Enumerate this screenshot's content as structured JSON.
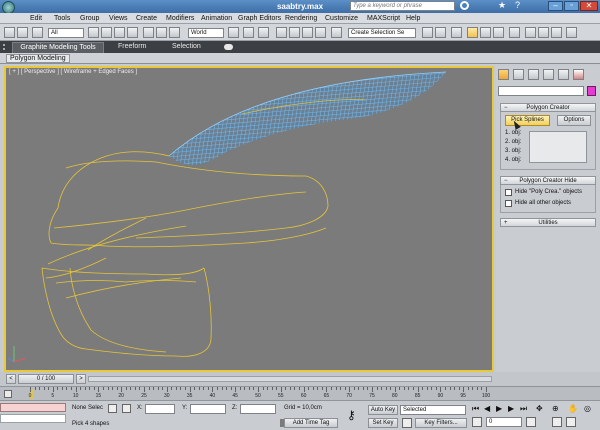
{
  "window": {
    "title": "saabtry.max",
    "search_placeholder": "Type a keyword or phrase"
  },
  "menu": [
    "Edit",
    "Tools",
    "Group",
    "Views",
    "Create",
    "Modifiers",
    "Animation",
    "Graph Editors",
    "Rendering",
    "Customize",
    "MAXScript",
    "Help"
  ],
  "toolbar": {
    "selection_filter": "All",
    "reference_coord": "World",
    "selection_set": "Create Selection Se"
  },
  "ribbon": {
    "tabs": [
      "Graphite Modeling Tools",
      "Freeform",
      "Selection"
    ],
    "subtab": "Polygon Modeling"
  },
  "viewport": {
    "label": "[ + ] [ Perspective ] [ Wireframe + Edged Faces ]"
  },
  "panel": {
    "rollout1": "Polygon Creator",
    "pick_button": "Pick Splines",
    "options_button": "Options",
    "list": [
      "1. obj:",
      "2. obj:",
      "3. obj:",
      "4. obj:"
    ],
    "rollout2": "Polygon Creator Hide",
    "checks": [
      "Hide \"Poly Crea.\" objects",
      "Hide all other objects"
    ],
    "rollout3": "Utilities"
  },
  "timeline": {
    "frame": "0 / 100",
    "ticks": [
      "0",
      "5",
      "10",
      "15",
      "20",
      "25",
      "30",
      "35",
      "40",
      "45",
      "50",
      "55",
      "60",
      "65",
      "70",
      "75",
      "80",
      "85",
      "90",
      "95",
      "100"
    ]
  },
  "status": {
    "none_selected": "None Selec",
    "prompt": "Pick 4 shapes",
    "x_label": "X:",
    "y_label": "Y:",
    "z_label": "Z:",
    "grid": "Grid = 10,0cm",
    "add_time_tag": "Add Time Tag",
    "auto_key": "Auto Key",
    "set_key": "Set Key",
    "selected": "Selected",
    "key_filters": "Key Filters...",
    "frame_value": "0"
  }
}
